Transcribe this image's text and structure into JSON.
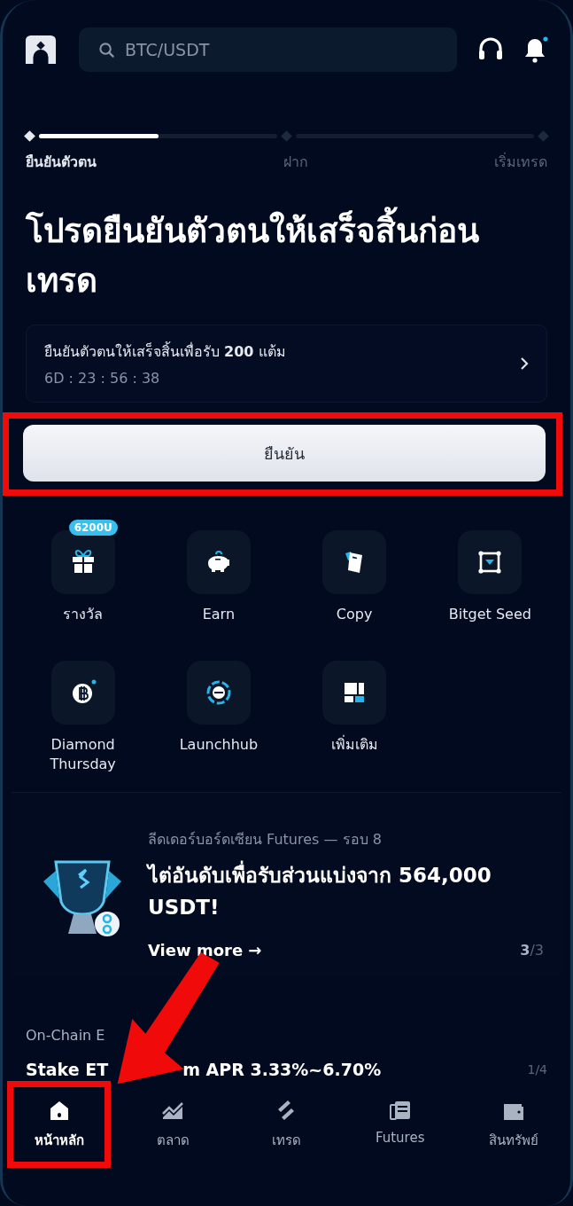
{
  "header": {
    "search": {
      "placeholder": "BTC/USDT"
    },
    "notification_dot": true
  },
  "steps": {
    "level": 0.5,
    "items": [
      {
        "label": "ยืนยันตัวตน",
        "selected": true
      },
      {
        "label": "ฝาก",
        "selected": false
      },
      {
        "label": "เริ่มเทรด",
        "selected": false
      }
    ]
  },
  "title": "โปรดยืนยันตัวตนให้เสร็จสิ้นก่อนเทรด",
  "reward_card": {
    "text": "ยืนยันตัวตนให้เสร็จสิ้นเพื่อรับ **200** แต้ม",
    "countdown": "6D : 23 : 56 : 38"
  },
  "confirm_button": "ยืนยัน",
  "shortcuts": [
    {
      "kind": "gift",
      "label": "รางวัล",
      "badge": "6200U"
    },
    {
      "kind": "piggy",
      "label": "Earn"
    },
    {
      "kind": "copy",
      "label": "Copy"
    },
    {
      "kind": "seed",
      "label": "Bitget Seed"
    },
    {
      "kind": "bitcoin",
      "label": "Diamond Thursday",
      "dot": true
    },
    {
      "kind": "launch",
      "label": "Launchhub"
    },
    {
      "kind": "more",
      "label": "เพิ่มเติม"
    }
  ],
  "banner": {
    "kicker": "ลีดเดอร์บอร์ดเซียน Futures — รอบ 8",
    "headline": "ไต่อันดับเพื่อรับส่วนแบ่งจาก 564,000 USDT!",
    "link": "View more →",
    "page": "3",
    "page_total": "/3"
  },
  "earn_section": {
    "title": "On-Chain E",
    "item_start": "Stake ET",
    "item_end": "m APR 3.33%~6.70%",
    "page": "1/4"
  },
  "nav": [
    {
      "kind": "home",
      "label": "หน้าหลัก",
      "selected": true
    },
    {
      "kind": "market",
      "label": "ตลาด",
      "selected": false
    },
    {
      "kind": "trade",
      "label": "เทรด",
      "selected": false
    },
    {
      "kind": "futures",
      "label": "Futures",
      "selected": false
    },
    {
      "kind": "wallet",
      "label": "สินทรัพย์",
      "selected": false
    }
  ],
  "annotations": {
    "highlight_button": true,
    "highlight_home": true,
    "arrow": true
  }
}
